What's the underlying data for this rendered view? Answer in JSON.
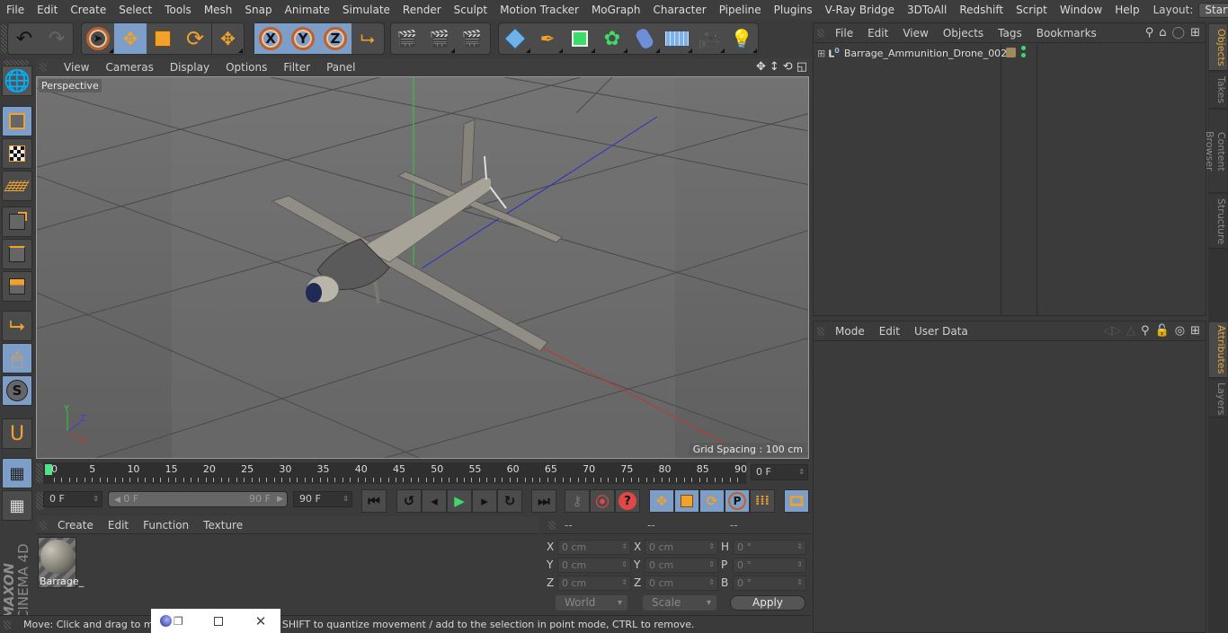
{
  "menubar": {
    "items": [
      "File",
      "Edit",
      "Create",
      "Select",
      "Tools",
      "Mesh",
      "Snap",
      "Animate",
      "Simulate",
      "Render",
      "Sculpt",
      "Motion Tracker",
      "MoGraph",
      "Character",
      "Pipeline",
      "Plugins",
      "V-Ray Bridge",
      "3DToAll",
      "Redshift",
      "Script",
      "Window",
      "Help"
    ],
    "layout_label": "Layout:",
    "layout_value": "Startup"
  },
  "toolbar": {
    "undo": "undo-icon",
    "redo": "redo-icon",
    "axis_x": "X",
    "axis_y": "Y",
    "axis_z": "Z"
  },
  "viewport": {
    "menu": [
      "View",
      "Cameras",
      "Display",
      "Options",
      "Filter",
      "Panel"
    ],
    "camera_label": "Perspective",
    "grid_spacing": "Grid Spacing : 100 cm",
    "axis_labels": {
      "x": "X",
      "y": "Y",
      "z": "Z"
    },
    "colors": {
      "x_axis": "#c0392b",
      "y_axis": "#2ecc40",
      "z_axis": "#2b2bd0"
    }
  },
  "timeline": {
    "ticks": [
      "0",
      "5",
      "10",
      "15",
      "20",
      "25",
      "30",
      "35",
      "40",
      "45",
      "50",
      "55",
      "60",
      "65",
      "70",
      "75",
      "80",
      "85",
      "90"
    ],
    "current_frame": "0 F",
    "start_field": "0 F",
    "range_start": "0 F",
    "range_end": "90 F",
    "end_field": "90 F"
  },
  "materials": {
    "menu": [
      "Create",
      "Edit",
      "Function",
      "Texture"
    ],
    "items": [
      {
        "name": "Barrage_"
      }
    ]
  },
  "coordinates": {
    "headers": [
      "--",
      "--",
      "--"
    ],
    "rows": [
      {
        "l1": "X",
        "v1": "0 cm",
        "l2": "X",
        "v2": "0 cm",
        "l3": "H",
        "v3": "0 °"
      },
      {
        "l1": "Y",
        "v1": "0 cm",
        "l2": "Y",
        "v2": "0 cm",
        "l3": "P",
        "v3": "0 °"
      },
      {
        "l1": "Z",
        "v1": "0 cm",
        "l2": "Z",
        "v2": "0 cm",
        "l3": "B",
        "v3": "0 °"
      }
    ],
    "space": "World",
    "mode": "Scale",
    "apply": "Apply"
  },
  "status": {
    "text": "Move: Click and drag to move elements. Hold down SHIFT to quantize movement / add to the selection in point mode, CTRL to remove."
  },
  "objects": {
    "menu": [
      "File",
      "Edit",
      "View",
      "Objects",
      "Tags",
      "Bookmarks"
    ],
    "items": [
      {
        "name": "Barrage_Ammunition_Drone_002",
        "layer_color": "#a08a5c"
      }
    ]
  },
  "attributes": {
    "menu": [
      "Mode",
      "Edit",
      "User Data"
    ]
  },
  "sidetabs": {
    "top": [
      "Objects",
      "Takes",
      "Content Browser",
      "Structure"
    ],
    "bottom": [
      "Attributes",
      "Layers"
    ]
  },
  "branding": {
    "maxon": "MAXON",
    "product": "CINEMA 4D"
  }
}
